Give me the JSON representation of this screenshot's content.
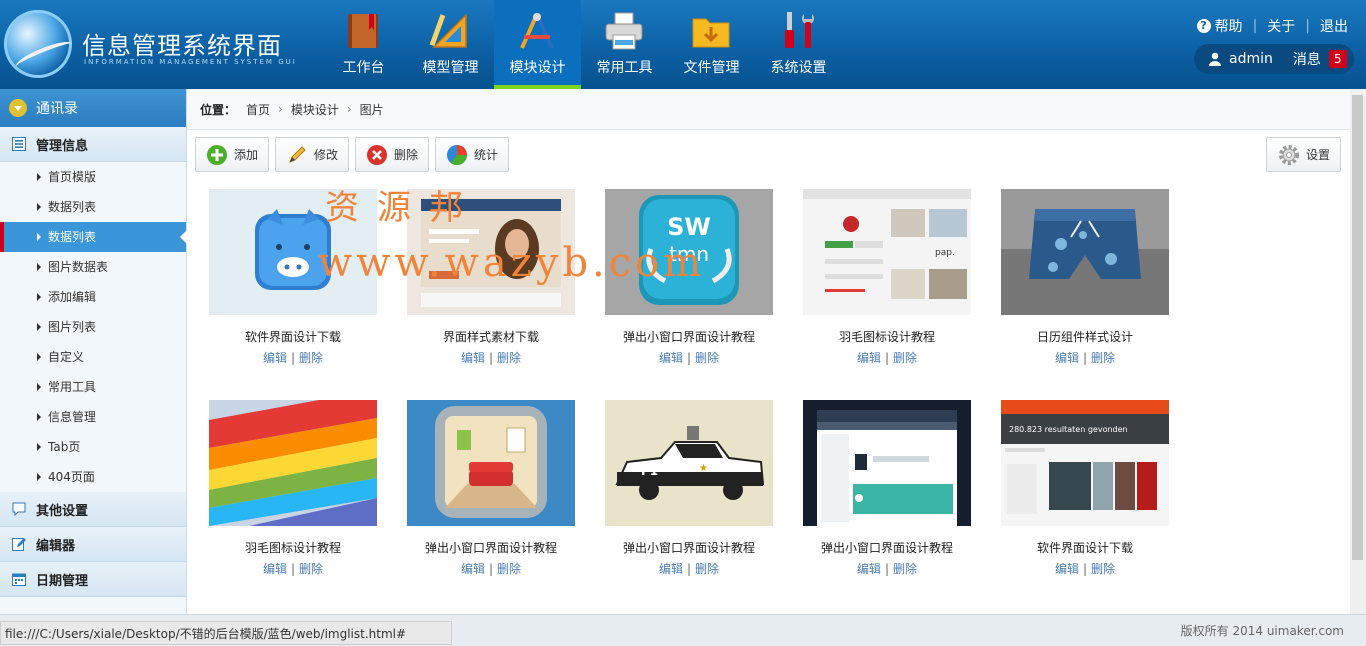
{
  "header": {
    "title": "信息管理系统界面",
    "subtitle": "INFORMATION MANAGEMENT SYSTEM GUI",
    "nav": [
      {
        "label": "工作台",
        "icon": "book-icon"
      },
      {
        "label": "模型管理",
        "icon": "ruler-triangle-icon"
      },
      {
        "label": "模块设计",
        "icon": "design-tools-icon",
        "active": true
      },
      {
        "label": "常用工具",
        "icon": "printer-icon"
      },
      {
        "label": "文件管理",
        "icon": "folder-icon"
      },
      {
        "label": "系统设置",
        "icon": "screwdriver-wrench-icon"
      }
    ],
    "links": {
      "help": "帮助",
      "about": "关于",
      "logout": "退出"
    },
    "user": {
      "name": "admin",
      "msg_label": "消息",
      "msg_count": "5"
    }
  },
  "sidebar": {
    "top": "通讯录",
    "section_main": "管理信息",
    "items": [
      {
        "label": "首页模版"
      },
      {
        "label": "数据列表"
      },
      {
        "label": "数据列表",
        "active": true
      },
      {
        "label": "图片数据表"
      },
      {
        "label": "添加编辑"
      },
      {
        "label": "图片列表"
      },
      {
        "label": "自定义"
      },
      {
        "label": "常用工具"
      },
      {
        "label": "信息管理"
      },
      {
        "label": "Tab页"
      },
      {
        "label": "404页面"
      }
    ],
    "sections": [
      "其他设置",
      "编辑器",
      "日期管理"
    ]
  },
  "breadcrumb": {
    "label": "位置：",
    "items": [
      "首页",
      "模块设计",
      "图片"
    ]
  },
  "toolbar": {
    "add": "添加",
    "edit": "修改",
    "delete": "删除",
    "stats": "统计",
    "settings": "设置"
  },
  "gallery": {
    "edit_label": "编辑",
    "sep": "|",
    "delete_label": "删除",
    "cards": [
      {
        "title": "软件界面设计下载"
      },
      {
        "title": "界面样式素材下载"
      },
      {
        "title": "弹出小窗口界面设计教程"
      },
      {
        "title": "羽毛图标设计教程"
      },
      {
        "title": "日历组件样式设计"
      },
      {
        "title": "羽毛图标设计教程"
      },
      {
        "title": "弹出小窗口界面设计教程"
      },
      {
        "title": "弹出小窗口界面设计教程"
      },
      {
        "title": "弹出小窗口界面设计教程"
      },
      {
        "title": "软件界面设计下载"
      }
    ]
  },
  "watermark": {
    "line1": "资源邦",
    "line2": "www.wazyb.com"
  },
  "status_url": "file:///C:/Users/xiale/Desktop/不错的后台模版/蓝色/web/imglist.html#",
  "copyright": "版权所有 2014 uimaker.com",
  "colors": {
    "header": "#0b5fa3",
    "active_tab_underline": "#7ed321",
    "sidebar_active": "#3a96d8",
    "badge": "#d0021b",
    "link": "#4c7fb4"
  }
}
